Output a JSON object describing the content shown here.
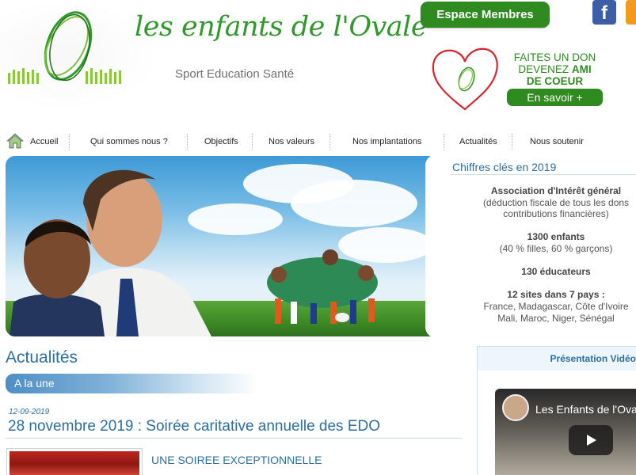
{
  "header": {
    "brand": "les enfants de l'Ovale",
    "tagline": "Sport Education Santé",
    "members_button": "Espace Membres",
    "facebook_glyph": "f",
    "donation": {
      "line1": "FAITES UN DON",
      "line2_prefix": "DEVENEZ",
      "line2_strong": "AMI",
      "line3": "DE COEUR",
      "button": "En savoir +"
    }
  },
  "nav": {
    "items": [
      "Accueil",
      "Qui sommes nous ?",
      "Objectifs",
      "Nos valeurs",
      "Nos implantations",
      "Actualités",
      "Nous soutenir"
    ]
  },
  "stats": {
    "title": "Chiffres clés en 2019",
    "lines": [
      "Association d'Intérêt général",
      "(déduction fiscale de tous les dons",
      "contributions financières)",
      "1300 enfants",
      "(40 % filles, 60 % garçons)",
      "130 éducateurs",
      "12 sites dans 7 pays :",
      "France, Madagascar, Côte d'Ivoire",
      "Mali, Maroc, Niger, Sénégal"
    ]
  },
  "news": {
    "heading": "Actualités",
    "featured_label": "A la une",
    "date": "12-09-2019",
    "title": "28 novembre 2019 : Soirée caritative annuelle des EDO",
    "subtitle": "UNE SOIREE EXCEPTIONNELLE"
  },
  "video": {
    "heading": "Présentation Vidéo",
    "title": "Les Enfants de l'Ovale"
  },
  "colors": {
    "brand_green": "#2f8b1f",
    "brand_blue": "#2a6fa3",
    "heart_red": "#d8262e"
  }
}
